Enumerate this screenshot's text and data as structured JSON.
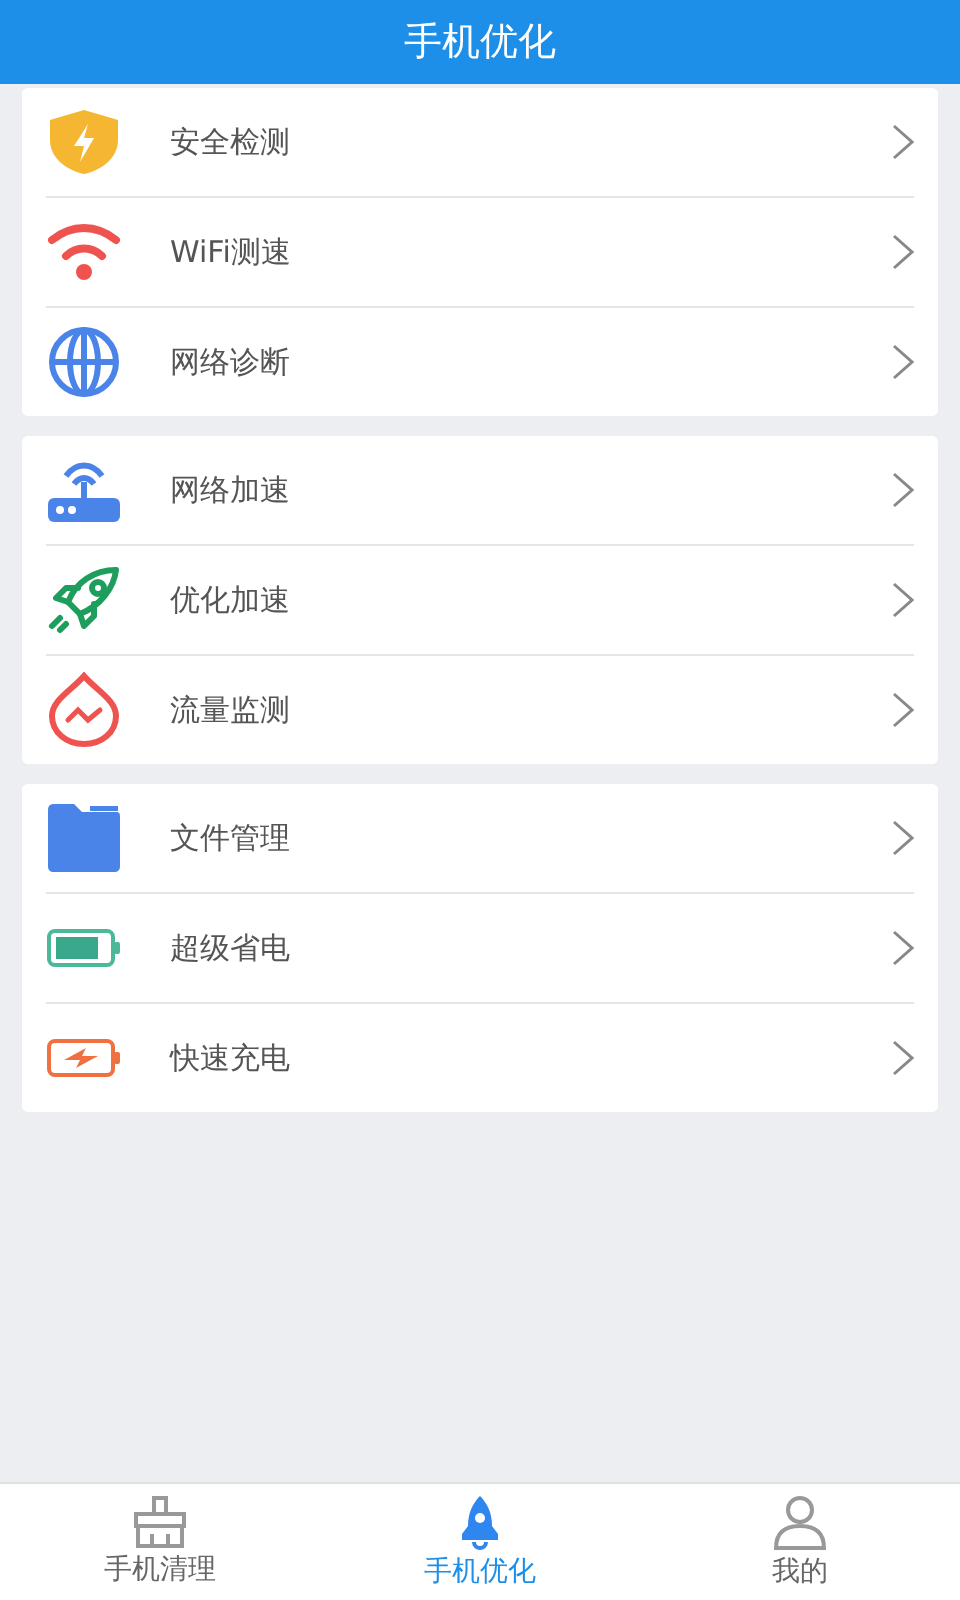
{
  "header": {
    "title": "手机优化"
  },
  "groups": [
    {
      "items": [
        {
          "label": "安全检测"
        },
        {
          "label": "WiFi测速"
        },
        {
          "label": "网络诊断"
        }
      ]
    },
    {
      "items": [
        {
          "label": "网络加速"
        },
        {
          "label": "优化加速"
        },
        {
          "label": "流量监测"
        }
      ]
    },
    {
      "items": [
        {
          "label": "文件管理"
        },
        {
          "label": "超级省电"
        },
        {
          "label": "快速充电"
        }
      ]
    }
  ],
  "tabs": [
    {
      "label": "手机清理",
      "selected": false
    },
    {
      "label": "手机优化",
      "selected": true
    },
    {
      "label": "我的",
      "selected": false
    }
  ]
}
